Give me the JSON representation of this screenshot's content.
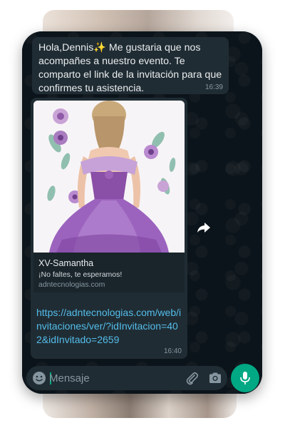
{
  "message_1": {
    "text": "Hola,Dennis✨ Me gustaria que nos acompañes a nuestro evento. Te comparto el link de la invitación para que confirmes tu asistencia.",
    "time": "16:39"
  },
  "message_2": {
    "link_title": "XV-Samantha",
    "link_description": "¡No faltes, te esperamos!",
    "link_domain": "adntecnologias.com",
    "url": "https://adntecnologias.com/web/invitaciones/ver/?idInvitacion=402&idInvitado=2659",
    "time": "16:40"
  },
  "composer": {
    "placeholder": "Mensaje"
  },
  "icons": {
    "forward": "forward-icon",
    "emoji": "emoji-icon",
    "attach": "paperclip-icon",
    "camera": "camera-icon",
    "mic": "microphone-icon"
  },
  "colors": {
    "background": "#0b141a",
    "bubble": "#202c33",
    "link": "#53bdeb",
    "accent": "#00a884"
  }
}
